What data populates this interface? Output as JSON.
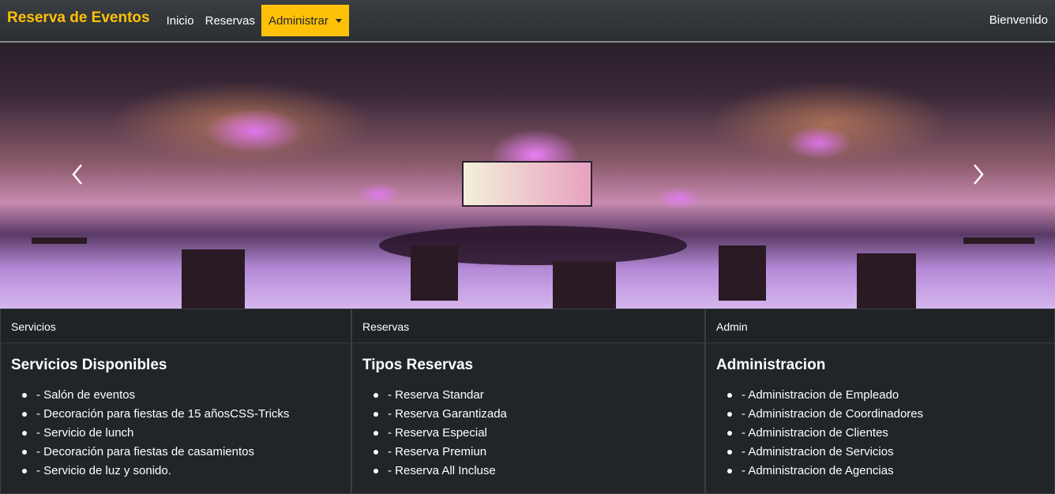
{
  "navbar": {
    "brand": "Reserva de Eventos",
    "links": [
      "Inicio",
      "Reservas"
    ],
    "dropdown_label": "Administrar",
    "welcome": "Bienvenido",
    "accent_color": "#ffc107"
  },
  "carousel": {
    "prev_icon": "chevron-left-icon",
    "next_icon": "chevron-right-icon"
  },
  "cards": [
    {
      "header": "Servicios",
      "title": "Servicios Disponibles",
      "items": [
        "- Salón de eventos",
        "- Decoración para fiestas de 15 añosCSS-Tricks",
        "- Servicio de lunch",
        "- Decoración para fiestas de casamientos",
        "- Servicio de luz y sonido."
      ]
    },
    {
      "header": "Reservas",
      "title": "Tipos Reservas",
      "items": [
        "- Reserva Standar",
        "- Reserva Garantizada",
        "- Reserva Especial",
        "- Reserva Premiun",
        "- Reserva All Incluse"
      ]
    },
    {
      "header": "Admin",
      "title": "Administracion",
      "items": [
        "- Administracion de Empleado",
        "- Administracion de Coordinadores",
        "- Administracion de Clientes",
        "- Administracion de Servicios",
        "- Administracion de Agencias"
      ]
    }
  ]
}
